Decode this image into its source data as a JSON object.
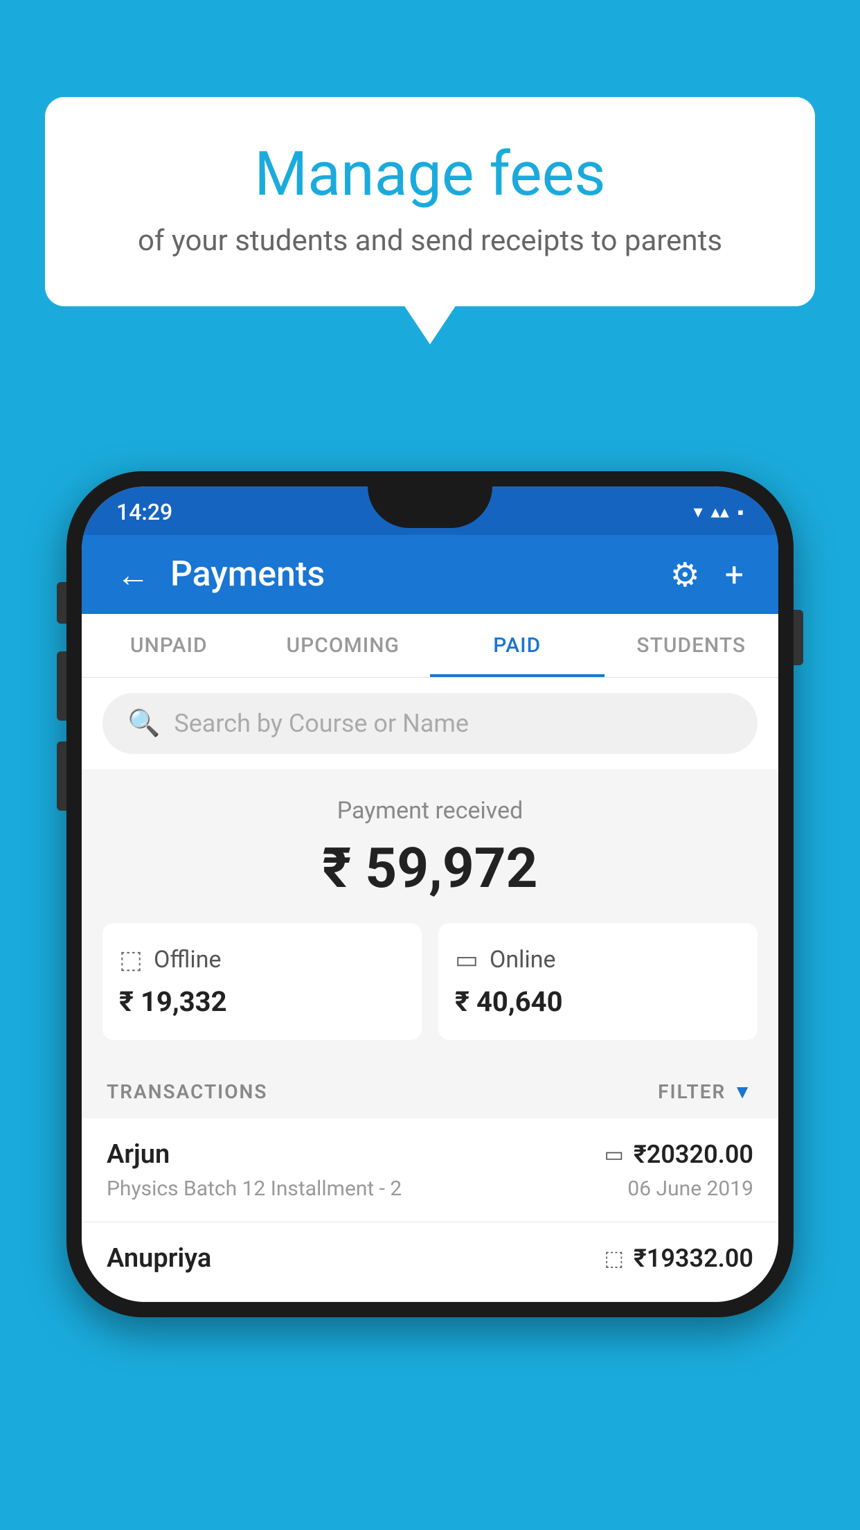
{
  "background_color": "#1AABDC",
  "speech_bubble": {
    "title": "Manage fees",
    "subtitle": "of your students and send receipts to parents"
  },
  "phone": {
    "status_bar": {
      "time": "14:29",
      "icons": "▾ ▾ ▪"
    },
    "app_bar": {
      "back_label": "←",
      "title": "Payments",
      "settings_icon": "⚙",
      "add_icon": "+"
    },
    "tabs": [
      {
        "label": "UNPAID",
        "active": false
      },
      {
        "label": "UPCOMING",
        "active": false
      },
      {
        "label": "PAID",
        "active": true
      },
      {
        "label": "STUDENTS",
        "active": false
      }
    ],
    "search": {
      "placeholder": "Search by Course or Name"
    },
    "payment_summary": {
      "label": "Payment received",
      "amount": "₹ 59,972",
      "offline": {
        "type": "Offline",
        "amount": "₹ 19,332"
      },
      "online": {
        "type": "Online",
        "amount": "₹ 40,640"
      }
    },
    "transactions_section": {
      "label": "TRANSACTIONS",
      "filter_label": "FILTER"
    },
    "transactions": [
      {
        "name": "Arjun",
        "payment_method": "card",
        "amount": "₹20320.00",
        "detail": "Physics Batch 12 Installment - 2",
        "date": "06 June 2019"
      },
      {
        "name": "Anupriya",
        "payment_method": "offline",
        "amount": "₹19332.00",
        "detail": "",
        "date": ""
      }
    ]
  }
}
